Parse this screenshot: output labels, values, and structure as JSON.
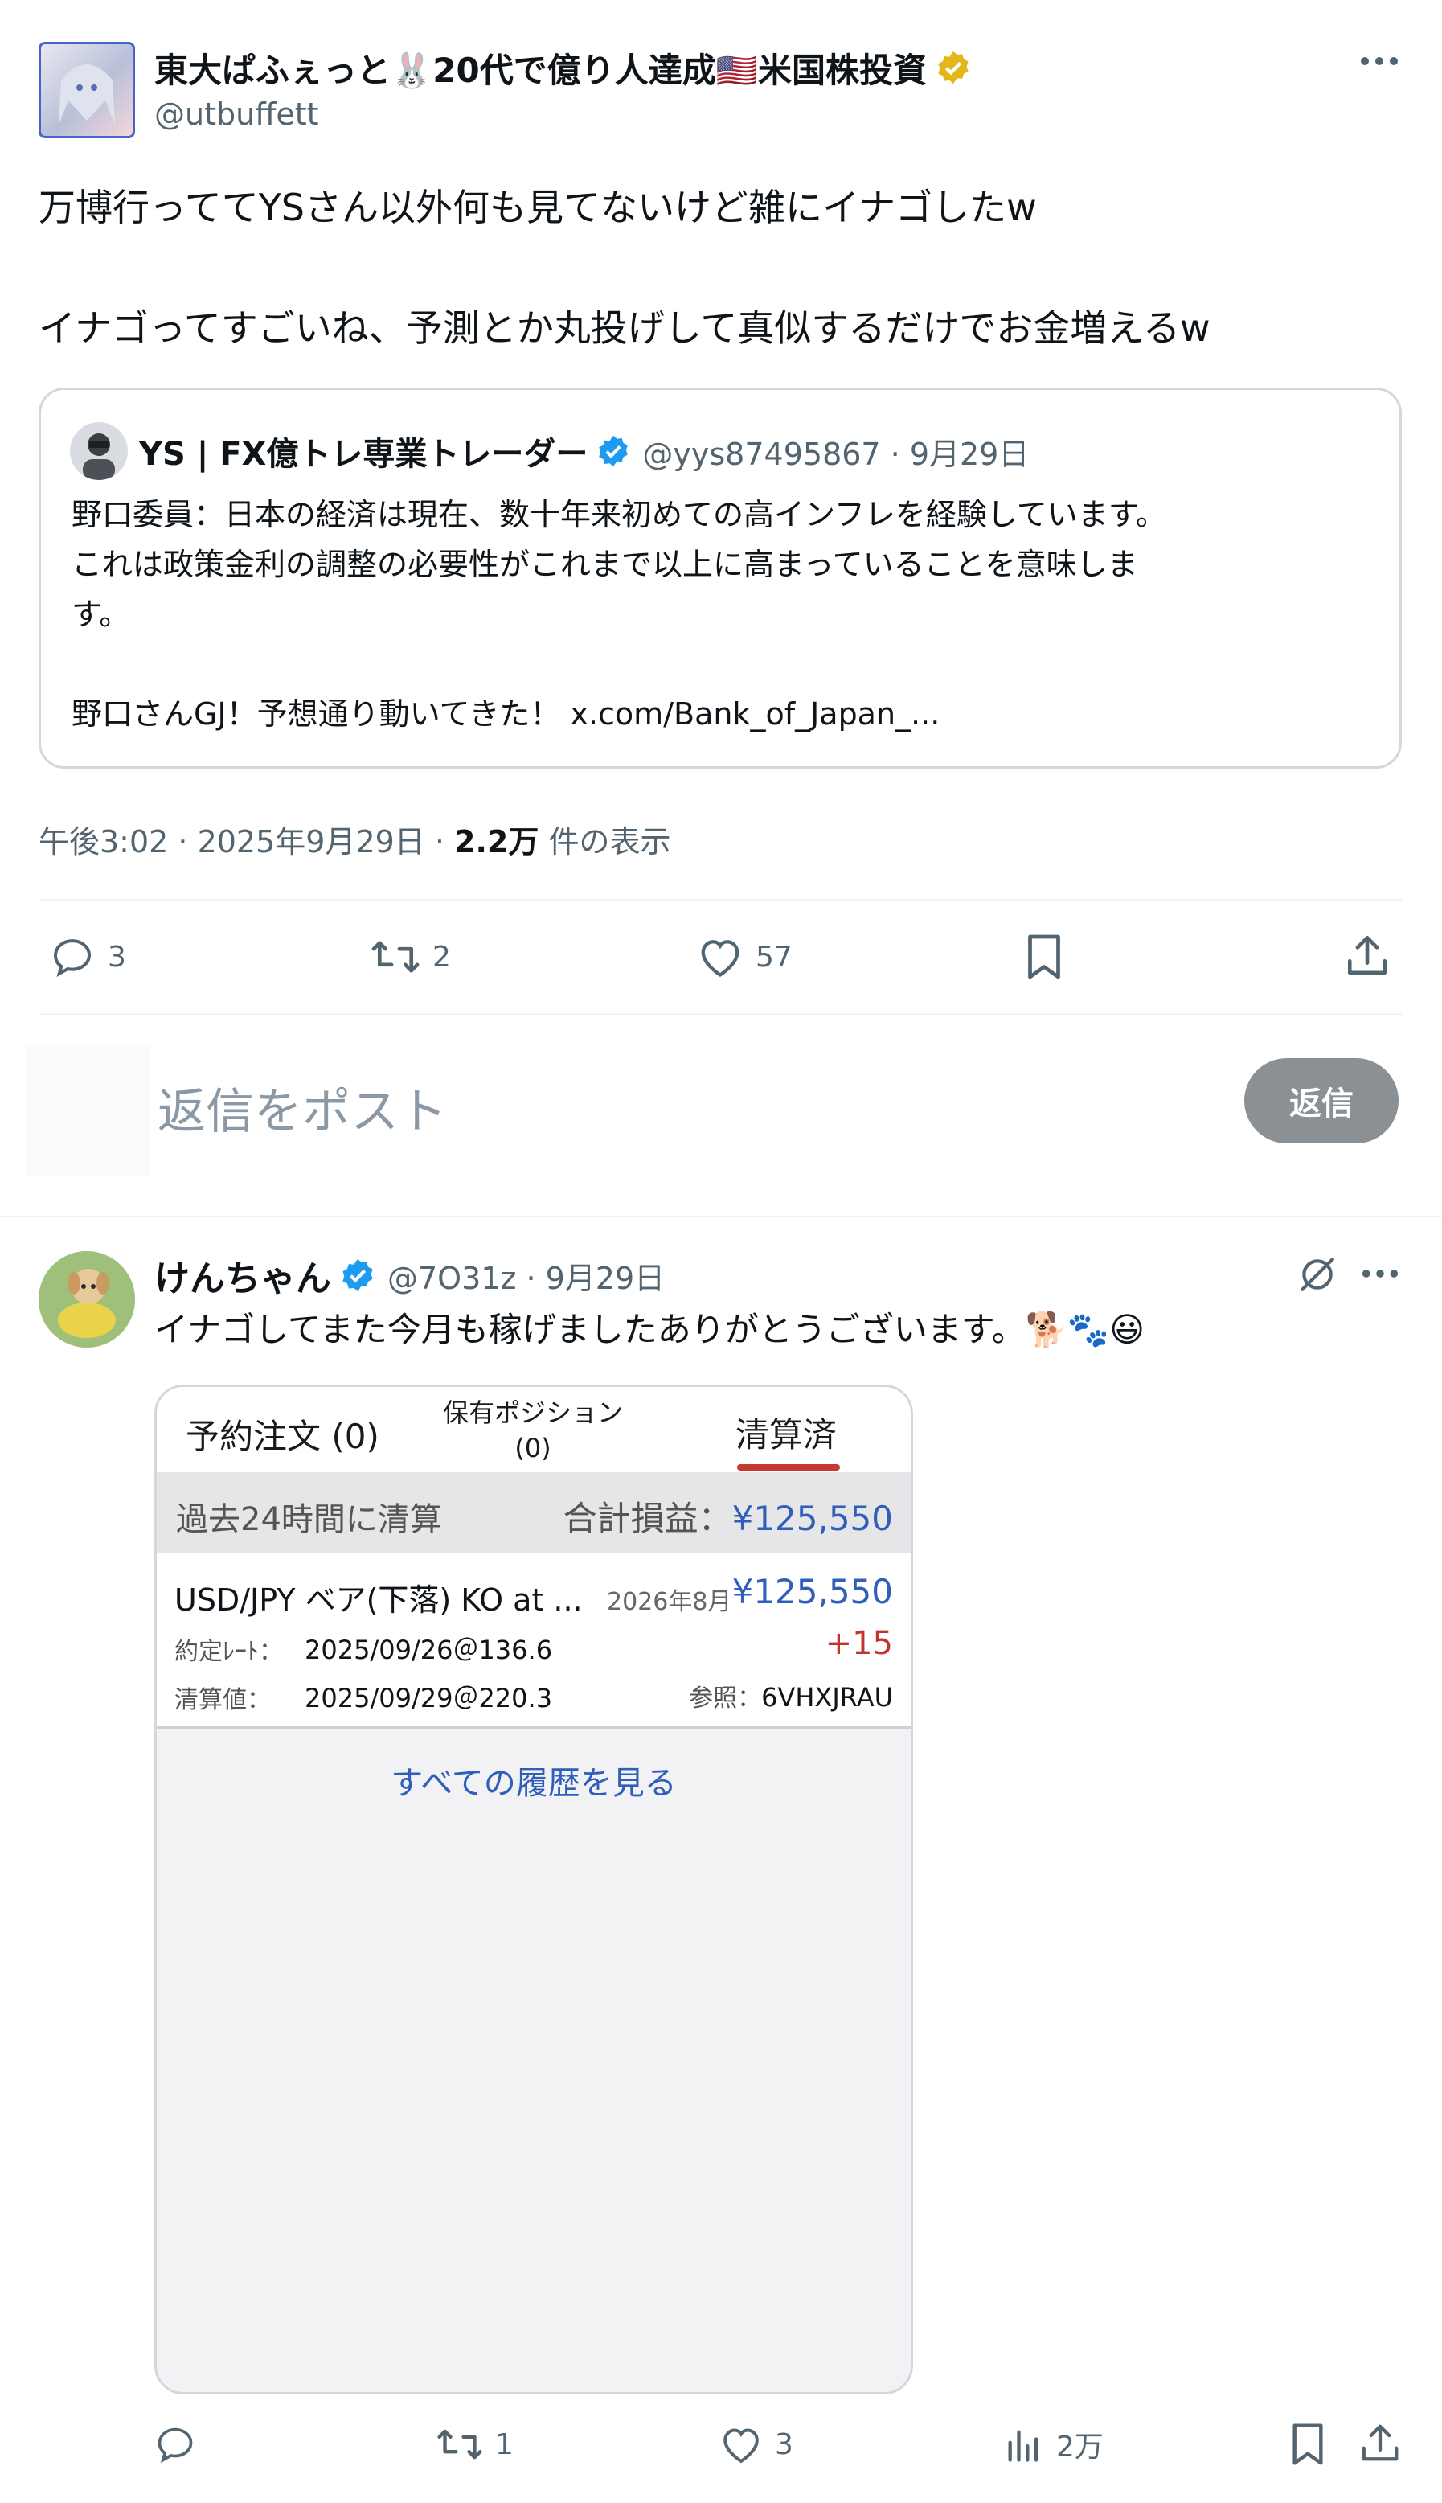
{
  "main_post": {
    "display_name": "東大ぱふぇっと🐰20代で億り人達成🇺🇸米国株投資",
    "handle": "@utbuffett",
    "text_line1": "万博行っててYSさん以外何も見てないけど雑にイナゴしたw",
    "text_line2": "イナゴってすごいね、予測とか丸投げして真似するだけでお金増えるw",
    "quote": {
      "display_name": "YS | FX億トレ専業トレーダー",
      "handle_date": "@yys87495867 · 9月29日",
      "line1": "野口委員：日本の経済は現在、数十年来初めての高インフレを経験しています。",
      "line2": "これは政策金利の調整の必要性がこれまで以上に高まっていることを意味しま",
      "line3": "す。",
      "line4_text": "野口さんGJ！予想通り動いてきた！ ",
      "line4_link": "x.com/Bank_of_Japan_..."
    },
    "timestamp": "午後3:02 · 2025年9月29日 · ",
    "views_count": "2.2万",
    "views_label": " 件の表示",
    "actions": {
      "replies": "3",
      "reposts": "2",
      "likes": "57"
    },
    "colors": {
      "verified_gold": "#e2b719",
      "verified_blue": "#1d9bf0"
    }
  },
  "reply_composer": {
    "placeholder": "返信をポスト",
    "button_label": "返信"
  },
  "reply_post": {
    "display_name": "けんちゃん",
    "handle_date": "@7O31z · 9月29日",
    "text": "イナゴしてまた今月も稼げましたありがとうございます。🐕🐾😃",
    "actions": {
      "replies": "",
      "reposts": "1",
      "likes": "3",
      "views": "2万"
    },
    "image": {
      "tab1": "予約注文 (0)",
      "tab2_line1": "保有ポジション",
      "tab2_line2": "(0)",
      "tab3": "清算済",
      "summary_label": "過去24時間に清算",
      "summary_total_label": "合計損益：",
      "summary_total_value": "¥125,550",
      "trade_title": "USD/JPY ベア(下落) KO at ...",
      "trade_expiry": "2026年8月",
      "trade_amount": "¥125,550",
      "rate_label": "約定ﾚｰﾄ：",
      "rate_value": "2025/09/26＠136.6",
      "rate_change": "+15",
      "settle_label": "清算値：",
      "settle_value": "2025/09/29＠220.3",
      "ref_label": "参照：",
      "ref_value": "6VHXJRAU",
      "history_link": "すべての履歴を見る"
    }
  }
}
